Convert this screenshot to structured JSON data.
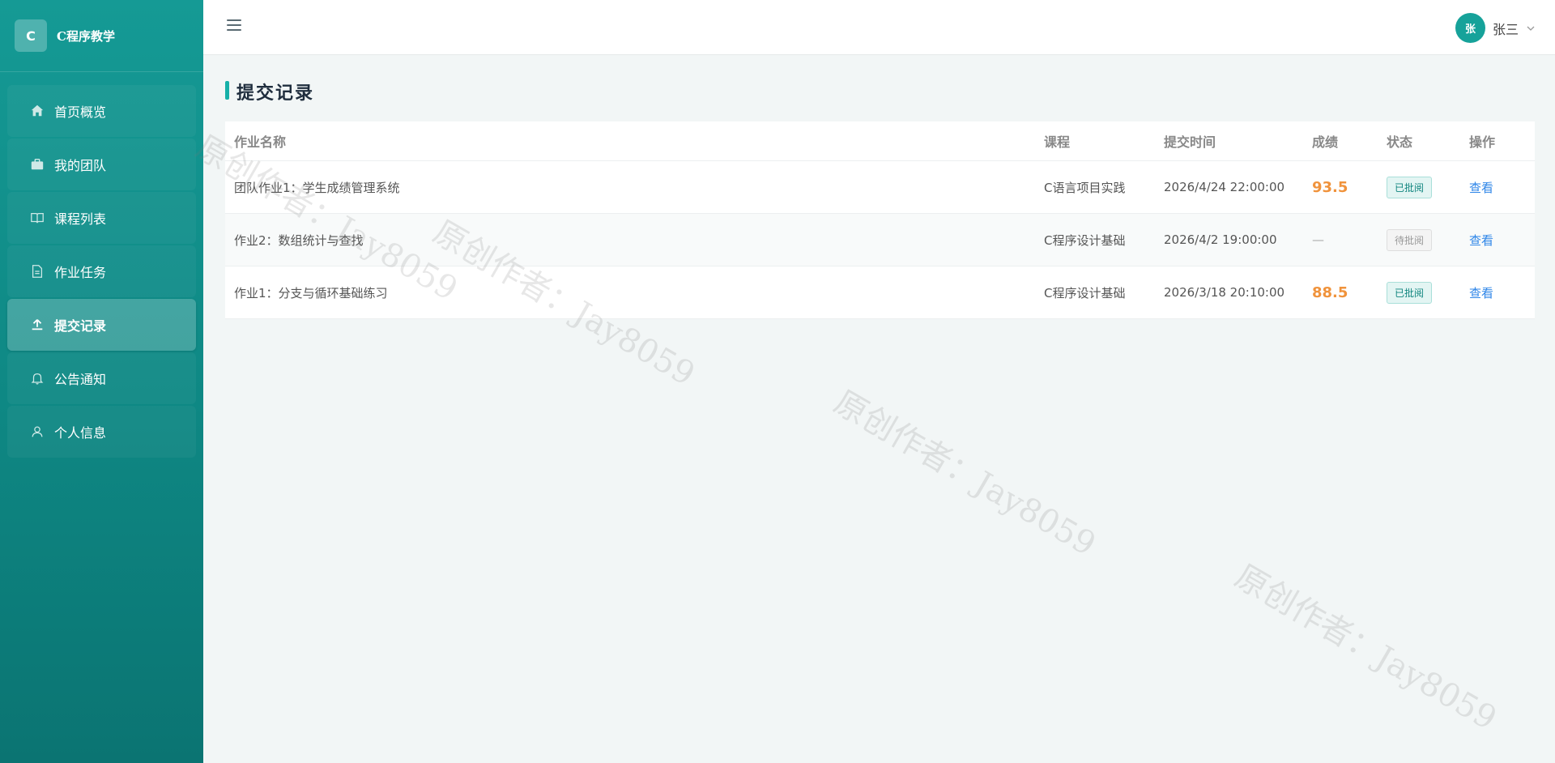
{
  "app": {
    "logo_letter": "C",
    "name": "C程序教学"
  },
  "sidebar": {
    "items": [
      {
        "label": "首页概览",
        "icon": "home-icon",
        "active": false
      },
      {
        "label": "我的团队",
        "icon": "briefcase-icon",
        "active": false
      },
      {
        "label": "课程列表",
        "icon": "book-icon",
        "active": false
      },
      {
        "label": "作业任务",
        "icon": "document-icon",
        "active": false
      },
      {
        "label": "提交记录",
        "icon": "upload-icon",
        "active": true
      },
      {
        "label": "公告通知",
        "icon": "bell-icon",
        "active": false
      },
      {
        "label": "个人信息",
        "icon": "user-icon",
        "active": false
      }
    ]
  },
  "header": {
    "avatar_text": "张",
    "user_name": "张三"
  },
  "page": {
    "title": "提交记录"
  },
  "table": {
    "columns": [
      "作业名称",
      "课程",
      "提交时间",
      "成绩",
      "状态",
      "操作"
    ],
    "rows": [
      {
        "name": "团队作业1：学生成绩管理系统",
        "course": "C语言项目实践",
        "time": "2026/4/24 22:00:00",
        "score": "93.5",
        "status": "已批阅",
        "action": "查看"
      },
      {
        "name": "作业2：数组统计与查找",
        "course": "C程序设计基础",
        "time": "2026/4/2 19:00:00",
        "score": "—",
        "status": "待批阅",
        "action": "查看"
      },
      {
        "name": "作业1：分支与循环基础练习",
        "course": "C程序设计基础",
        "time": "2026/3/18 20:10:00",
        "score": "88.5",
        "status": "已批阅",
        "action": "查看"
      }
    ]
  },
  "watermark": {
    "text": "原创作者：Jay8059"
  },
  "colors": {
    "accent": "#16b0a8",
    "score": "#f0933c",
    "link": "#2f86e8",
    "sidebar": "#0e8783"
  }
}
